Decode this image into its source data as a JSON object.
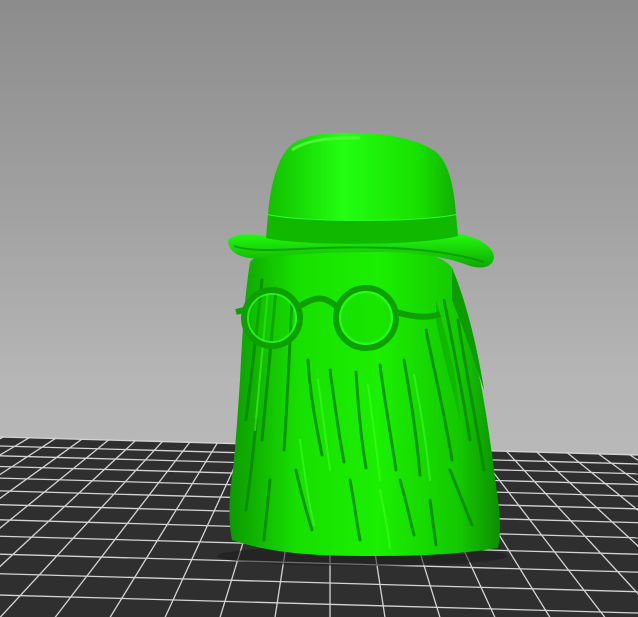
{
  "viewport": {
    "background_top": "#8c8c8c",
    "background_bottom": "#bcbcbc"
  },
  "bed": {
    "plate_color": "#2f2f2f",
    "grid_line_color": "#d4d4d4"
  },
  "model": {
    "icon": "cousin-itt-figurine-icon",
    "color": "#12e600",
    "shadow_color": "#0a8f00",
    "highlight_color": "#4dff33"
  }
}
